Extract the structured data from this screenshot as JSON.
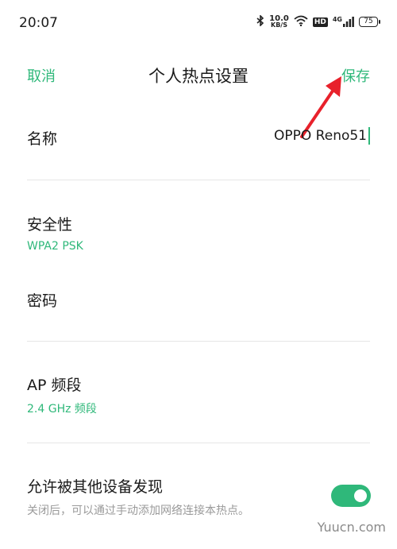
{
  "status_bar": {
    "time": "20:07",
    "network_speed_value": "10.0",
    "network_speed_unit": "KB/S",
    "hd_label": "HD",
    "network_type": "4G",
    "battery_level": "75"
  },
  "header": {
    "cancel_label": "取消",
    "title": "个人热点设置",
    "save_label": "保存"
  },
  "settings": {
    "name": {
      "label": "名称",
      "value": "OPPO Reno51"
    },
    "security": {
      "label": "安全性",
      "value": "WPA2 PSK"
    },
    "password": {
      "label": "密码"
    },
    "ap_band": {
      "label": "AP 频段",
      "value": "2.4 GHz 频段"
    },
    "discoverable": {
      "label": "允许被其他设备发现",
      "description": "关闭后，可以通过手动添加网络连接本热点。",
      "enabled": true
    }
  },
  "watermark": "Yuucn.com",
  "colors": {
    "accent": "#2fb87a",
    "annotation": "#e8212b"
  }
}
